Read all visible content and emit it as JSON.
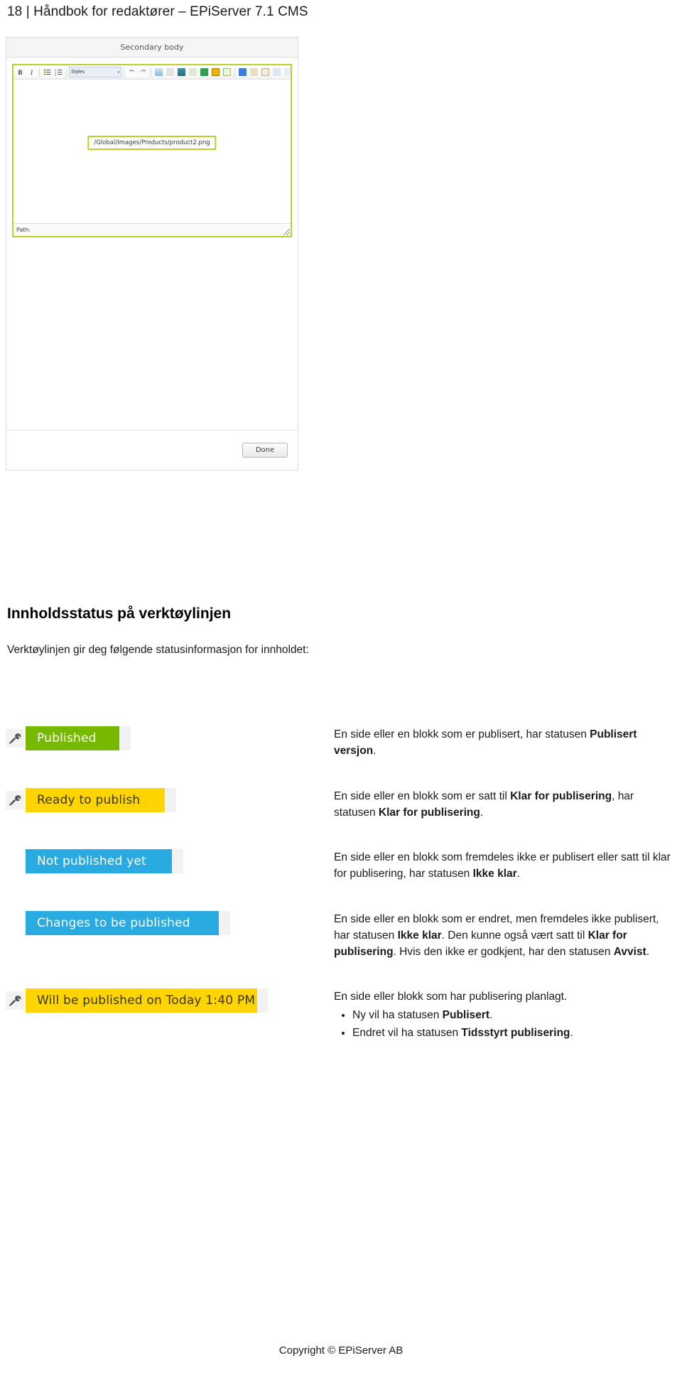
{
  "header": {
    "title": "18 | Håndbok for redaktører – EPiServer 7.1 CMS"
  },
  "figure": {
    "panel_title": "Secondary body",
    "toolbar": {
      "bold_label": "B",
      "italic_label": "I",
      "styles_label": "Styles",
      "styles_caret": "▾",
      "icons": [
        "bold-icon",
        "italic-icon",
        "bullet-list-icon",
        "numbered-list-icon",
        "styles-dropdown",
        "undo-icon",
        "redo-icon",
        "find-icon",
        "paste-icon",
        "insert-image-icon",
        "spellcheck-icon",
        "insert-link-icon",
        "insert-table-icon",
        "insert-block-icon",
        "anchor-icon",
        "copy-icon",
        "clipboard-icon",
        "paste-word-icon",
        "paste-text-icon",
        "search-icon",
        "fullscreen-icon"
      ]
    },
    "image_placeholder_path": "/Global/Images/Products/product2.png",
    "path_label": "Path:",
    "done_button": "Done"
  },
  "section": {
    "heading": "Innholdsstatus på verktøylinjen",
    "intro": "Verktøylinjen gir deg følgende statusinformasjon for innholdet:"
  },
  "statuses": [
    {
      "badge_label": "Published",
      "badge_color": "#76b900",
      "badge_text_color": "#ffffff",
      "has_tool_icon": true,
      "badge_width": 148,
      "text_html": "En side eller en blokk som er publisert, har statusen <b>Publisert versjon</b>."
    },
    {
      "badge_label": "Ready to publish",
      "badge_color": "#ffd400",
      "badge_text_color": "#3a3a00",
      "has_tool_icon": true,
      "badge_width": 212,
      "text_html": "En side eller en blokk som er satt til <b>Klar for publisering</b>, har statusen <b>Klar for publisering</b>."
    },
    {
      "badge_label": "Not published yet",
      "badge_color": "#29abe2",
      "badge_text_color": "#ffffff",
      "has_tool_icon": false,
      "badge_width": 222,
      "text_html": "En side eller en blokk som fremdeles ikke er publisert eller satt til klar for publisering, har statusen <b>Ikke klar</b>."
    },
    {
      "badge_label": "Changes to be published",
      "badge_color": "#29abe2",
      "badge_text_color": "#ffffff",
      "has_tool_icon": false,
      "badge_width": 288,
      "text_html": "En side eller en blokk som er endret, men fremdeles ikke publisert, har statusen <b>Ikke klar</b>. Den kunne også vært satt til <b>Klar for publisering</b>. Hvis den ikke er godkjent, har den statusen <b>Avvist</b>."
    },
    {
      "badge_label": "Will be published on Today 1:40 PM",
      "badge_color": "#ffd400",
      "badge_text_color": "#3a3a00",
      "has_tool_icon": true,
      "badge_width": 342,
      "text_html": "En side eller blokk som har publisering planlagt.",
      "bullets": [
        "Ny vil ha statusen <b>Publisert</b>.",
        "Endret vil ha statusen <b>Tidsstyrt publisering</b>."
      ]
    }
  ],
  "footer": {
    "copyright": "Copyright © EPiServer AB"
  }
}
